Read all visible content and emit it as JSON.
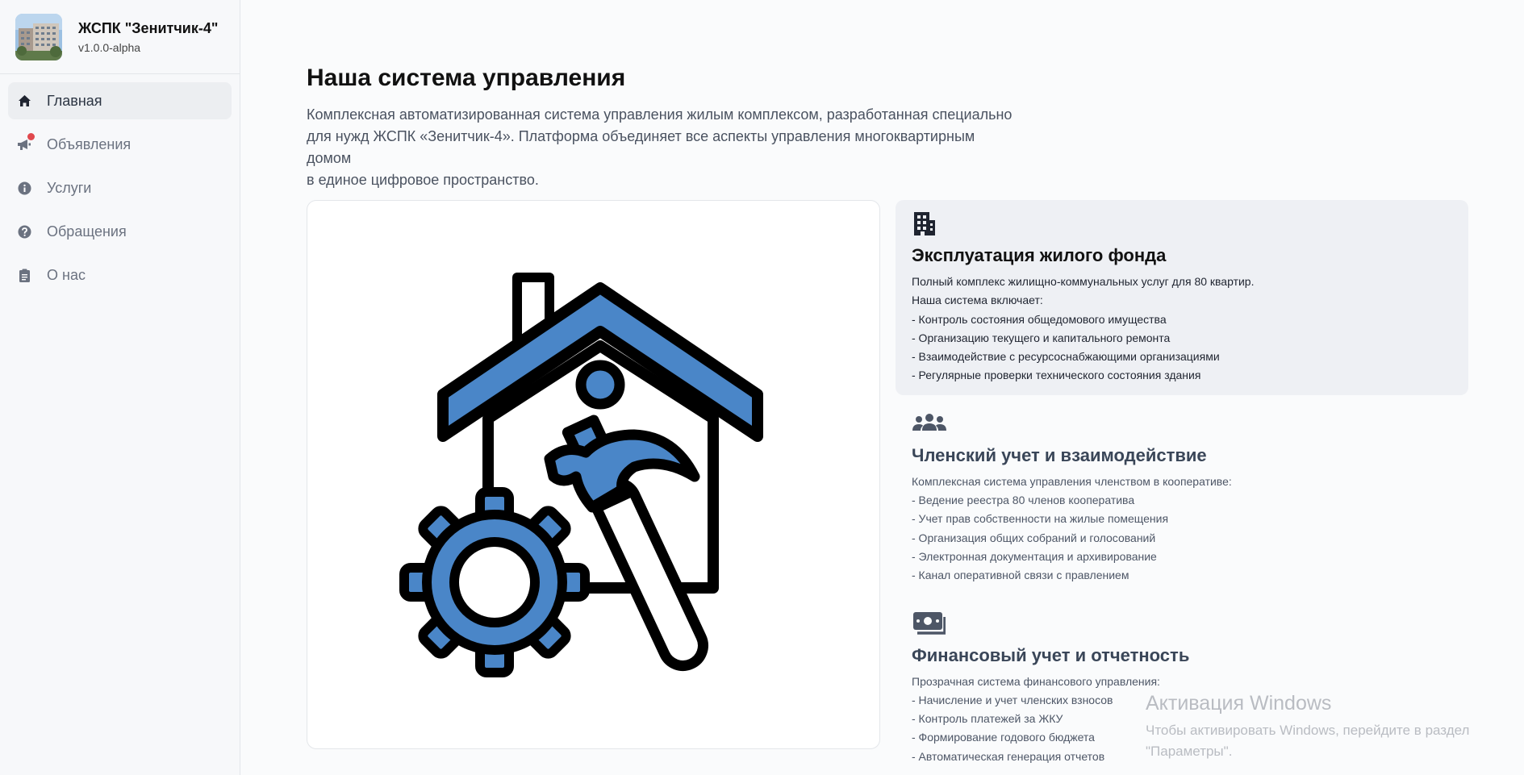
{
  "brand": {
    "title": "ЖСПК \"Зенитчик-4\"",
    "version": "v1.0.0-alpha"
  },
  "nav": [
    {
      "label": "Главная",
      "icon": "home-icon",
      "active": true
    },
    {
      "label": "Объявления",
      "icon": "megaphone-icon",
      "notification": true
    },
    {
      "label": "Услуги",
      "icon": "info-icon"
    },
    {
      "label": "Обращения",
      "icon": "question-icon"
    },
    {
      "label": "О нас",
      "icon": "clipboard-icon"
    }
  ],
  "main": {
    "title": "Наша система управления",
    "intro_lines": [
      "Комплексная автоматизированная система управления жилым комплексом, разработанная специально",
      "для нужд ЖСПК «Зенитчик-4». Платформа объединяет все аспекты управления многоквартирным домом",
      "в единое цифровое пространство."
    ],
    "illustration": "house-repair-icon",
    "features": [
      {
        "icon": "building-icon",
        "title": "Эксплуатация жилого фонда",
        "lines": [
          "Полный комплекс жилищно-коммунальных услуг для 80 квартир.",
          "Наша система включает:",
          "- Контроль состояния общедомового имущества",
          "- Организацию текущего и капитального ремонта",
          "- Взаимодействие с ресурсоснабжающими организациями",
          "- Регулярные проверки технического состояния здания"
        ]
      },
      {
        "icon": "users-icon",
        "title": "Членский учет и взаимодействие",
        "lines": [
          "Комплексная система управления членством в кооперативе:",
          "- Ведение реестра 80 членов кооператива",
          "- Учет прав собственности на жилые помещения",
          "- Организация общих собраний и голосований",
          "- Электронная документация и архивирование",
          "- Канал оперативной связи с правлением"
        ]
      },
      {
        "icon": "money-icon",
        "title": "Финансовый учет и отчетность",
        "lines": [
          "Прозрачная система финансового управления:",
          "- Начисление и учет членских взносов",
          "- Контроль платежей за ЖКУ",
          "- Формирование годового бюджета",
          "- Автоматическая генерация отчетов"
        ]
      }
    ]
  },
  "watermark": {
    "title": "Активация Windows",
    "text": "Чтобы активировать Windows, перейдите в раздел \"Параметры\"."
  },
  "colors": {
    "accent_blue": "#4a86c8",
    "outline": "#000000",
    "notification_red": "#e0484d",
    "sidebar_bg": "#f7f8fa",
    "active_nav_bg": "#eceef1"
  }
}
